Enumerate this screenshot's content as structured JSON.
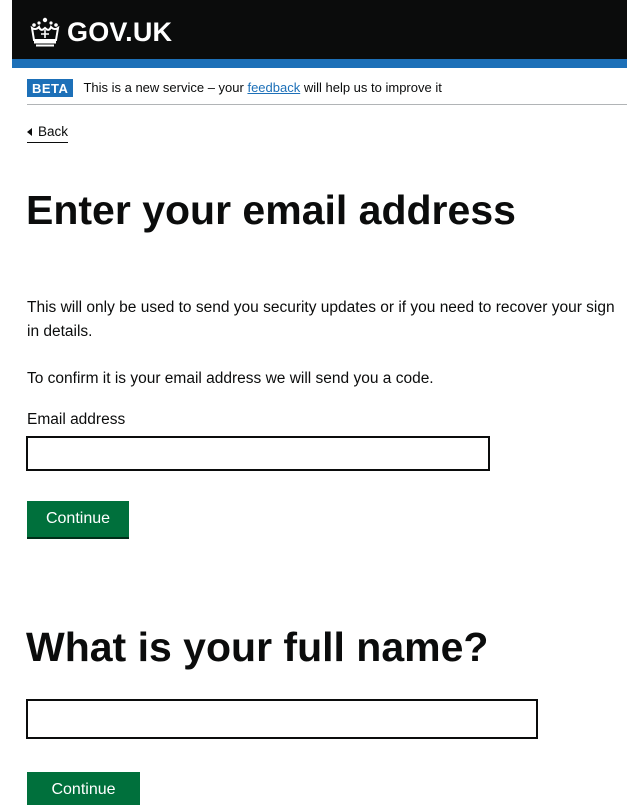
{
  "header": {
    "logo_text": "GOV.UK",
    "logo_icon": "crown-icon",
    "brand_color": "#0b0c0c",
    "accent_color": "#1d70b8"
  },
  "phase_banner": {
    "tag": "BETA",
    "text_before": "This is a new service – your ",
    "link_text": "feedback",
    "text_after": " will help us to improve it"
  },
  "back_link": {
    "label": "Back",
    "icon": "back-arrow-icon"
  },
  "email_section": {
    "title": "Enter your email address",
    "paragraph_1": "This will only be used to send you security updates or if you need to recover your sign in details.",
    "paragraph_2": "To confirm it is your email address we will send you a code.",
    "field_label": "Email address",
    "field_value": "",
    "button_label": "Continue",
    "button_color": "#00703c"
  },
  "name_section": {
    "title": "What is your full name?",
    "field_value": "",
    "button_label": "Continue",
    "button_color": "#00703c"
  }
}
